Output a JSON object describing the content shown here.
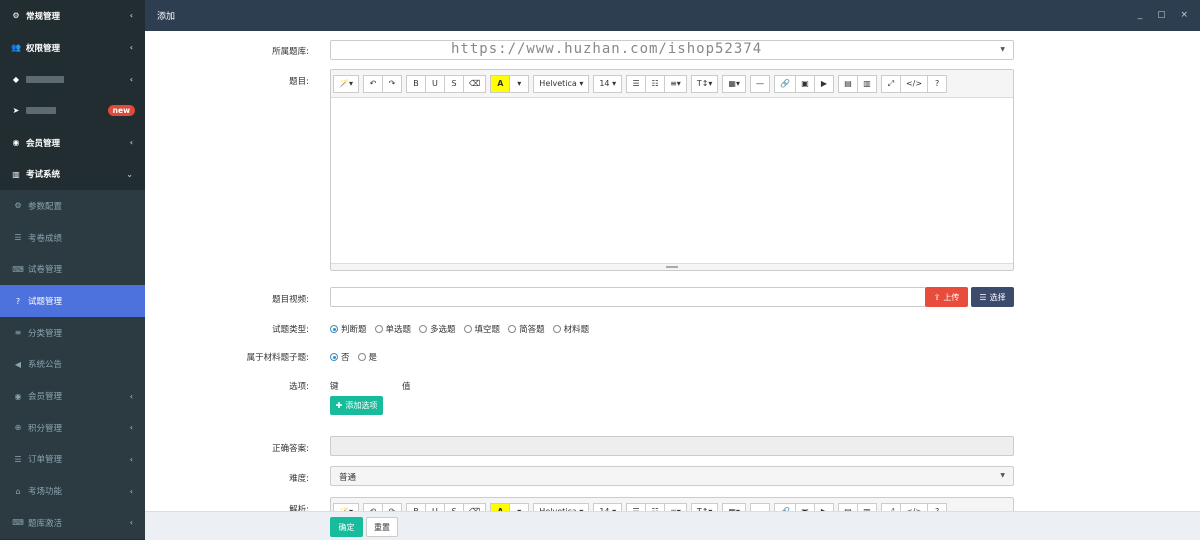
{
  "sidebar": {
    "items": [
      {
        "icon": "gears-icon",
        "glyph": "⚙",
        "label": "常规管理",
        "arrow": "‹",
        "type": "top"
      },
      {
        "icon": "users-icon",
        "glyph": "👥",
        "label": "权限管理",
        "arrow": "‹",
        "type": "top"
      },
      {
        "icon": "diamond-icon",
        "glyph": "◆",
        "label": "",
        "arrow": "‹",
        "type": "top",
        "blurred": true
      },
      {
        "icon": "rocket-icon",
        "glyph": "➤",
        "label": "",
        "badge": "new",
        "type": "top",
        "blurred": true
      },
      {
        "icon": "user-circle-icon",
        "glyph": "◉",
        "label": "会员管理",
        "arrow": "‹",
        "type": "top"
      },
      {
        "icon": "book-icon",
        "glyph": "▥",
        "label": "考试系统",
        "arrow": "⌄",
        "type": "top"
      },
      {
        "icon": "gears-icon",
        "glyph": "⚙",
        "label": "参数配置",
        "type": "child"
      },
      {
        "icon": "list-icon",
        "glyph": "☰",
        "label": "考卷成绩",
        "type": "child"
      },
      {
        "icon": "keyboard-icon",
        "glyph": "⌨",
        "label": "试卷管理",
        "type": "child"
      },
      {
        "icon": "question-circle-icon",
        "glyph": "?",
        "label": "试题管理",
        "type": "child",
        "active": true
      },
      {
        "icon": "align-left-icon",
        "glyph": "≡",
        "label": "分类管理",
        "type": "child"
      },
      {
        "icon": "volume-icon",
        "glyph": "◀",
        "label": "系统公告",
        "type": "child"
      },
      {
        "icon": "user-circle-icon",
        "glyph": "◉",
        "label": "会员管理",
        "arrow": "‹",
        "type": "child"
      },
      {
        "icon": "plus-circle-icon",
        "glyph": "⊕",
        "label": "积分管理",
        "arrow": "‹",
        "type": "child"
      },
      {
        "icon": "list-icon",
        "glyph": "☰",
        "label": "订单管理",
        "arrow": "‹",
        "type": "child"
      },
      {
        "icon": "home-icon",
        "glyph": "⌂",
        "label": "考场功能",
        "arrow": "‹",
        "type": "child"
      },
      {
        "icon": "keyboard-icon",
        "glyph": "⌨",
        "label": "题库激活",
        "arrow": "‹",
        "type": "child"
      }
    ]
  },
  "topbar": {
    "title": "添加",
    "controls": "_ ▢ ×"
  },
  "form": {
    "bank_label": "所属题库:",
    "bank_value": "",
    "watermark": "https://www.huzhan.com/ishop52374",
    "title_label": "题目:",
    "video_label": "题目视频:",
    "upload_label": "上传",
    "choose_label": "选择",
    "type_label": "试题类型:",
    "types": [
      {
        "label": "判断题",
        "checked": true
      },
      {
        "label": "单选题",
        "checked": false
      },
      {
        "label": "多选题",
        "checked": false
      },
      {
        "label": "填空题",
        "checked": false
      },
      {
        "label": "简答题",
        "checked": false
      },
      {
        "label": "材料题",
        "checked": false
      }
    ],
    "material_label": "属于材料题子题:",
    "material_options": [
      {
        "label": "否",
        "checked": true
      },
      {
        "label": "是",
        "checked": false
      }
    ],
    "options_label": "选项:",
    "key_header": "键",
    "value_header": "值",
    "add_option_label": "添加选项",
    "answer_label": "正确答案:",
    "difficulty_label": "难度:",
    "difficulty_value": "普通",
    "analysis_label": "解析:"
  },
  "toolbar": {
    "font_name": "Helvetica",
    "font_size": "14",
    "buttons": [
      "magic-icon",
      "undo-icon",
      "redo-icon",
      "bold-icon",
      "underline-icon",
      "strikethrough-icon",
      "eraser-icon",
      "highlight-icon",
      "font-name",
      "font-size",
      "ul-icon",
      "ol-icon",
      "align-icon",
      "text-height-icon",
      "table-icon",
      "hr-icon",
      "link-icon",
      "image-icon",
      "video-icon",
      "file-icon",
      "doc-icon",
      "fullscreen-icon",
      "code-icon",
      "help-icon"
    ]
  },
  "footer": {
    "confirm_label": "确定",
    "reset_label": "重置"
  },
  "colors": {
    "sidebar_bg": "#222d32",
    "active": "#4d72dd",
    "topbar": "#2c3e50",
    "upload": "#e74c3c",
    "choose": "#3c4a6b",
    "add": "#18bc9c",
    "confirm": "#18bc9c"
  }
}
